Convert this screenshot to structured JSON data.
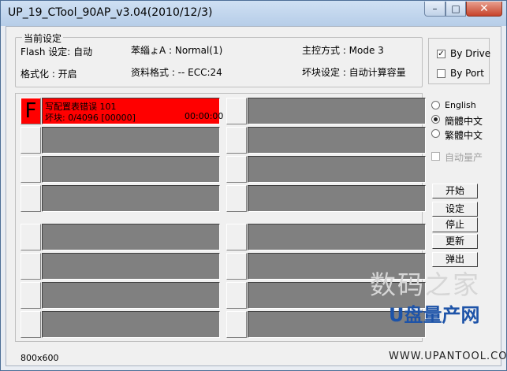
{
  "window": {
    "title": "UP_19_CTool_90AP_v3.04(2010/12/3)",
    "minimize": "–",
    "maximize": "□",
    "close": "✕"
  },
  "settings": {
    "legend": "当前设定",
    "flash": "Flash 设定: 自动",
    "format": "格式化 : 开启",
    "mode_a": "苯緇ょA : Normal(1)",
    "data_format": "资料格式 : -- ECC:24",
    "controller_mode": "主控方式 : Mode 3",
    "bad_block": "坏块设定 : 自动计算容量"
  },
  "drive_options": {
    "by_drive": "By Drive",
    "by_drive_checked": true,
    "by_port": "By Port",
    "by_port_checked": false
  },
  "language": {
    "english": "English",
    "simplified": "簡體中文",
    "traditional": "繁體中文",
    "selected": "simplified"
  },
  "auto_mass": {
    "label": "自动量产",
    "enabled": false
  },
  "buttons": {
    "start": "开始",
    "settings": "设定",
    "stop": "停止",
    "update": "更新",
    "eject": "弹出"
  },
  "ports": {
    "failed_letter": "F",
    "failed_line1": "写配置表错误 101",
    "failed_line2": "坏块: 0/4096 [00000]",
    "failed_time": "00:00:00"
  },
  "status_bar": {
    "resolution": "800x600"
  },
  "watermark": {
    "top": "数码之家",
    "middle": "U盘量产网",
    "url": "WWW.UPANTOOL.COM"
  }
}
